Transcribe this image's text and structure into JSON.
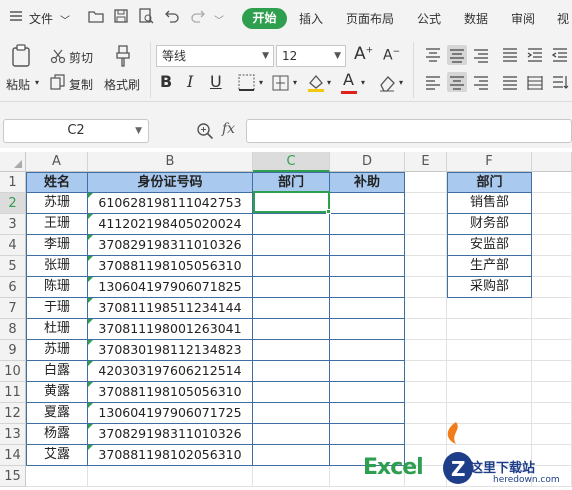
{
  "menubar": {
    "file": "文件",
    "tabs": [
      "开始",
      "插入",
      "页面布局",
      "公式",
      "数据",
      "审阅",
      "视"
    ]
  },
  "ribbon": {
    "paste": "粘贴",
    "cut": "剪切",
    "copy": "复制",
    "format_painter": "格式刷",
    "font_name": "等线",
    "font_size": "12"
  },
  "formula_bar": {
    "name_box": "C2",
    "fx": "fx",
    "value": ""
  },
  "grid": {
    "columns": [
      "A",
      "B",
      "C",
      "D",
      "E",
      "F"
    ],
    "rows": [
      "1",
      "2",
      "3",
      "4",
      "5",
      "6",
      "7",
      "8",
      "9",
      "10",
      "11",
      "12",
      "13",
      "14",
      "15"
    ],
    "headers": [
      "姓名",
      "身份证号码",
      "部门",
      "补助"
    ],
    "records": [
      {
        "name": "苏珊",
        "id": "610628198111042753"
      },
      {
        "name": "王珊",
        "id": "411202198405020024"
      },
      {
        "name": "李珊",
        "id": "370829198311010326"
      },
      {
        "name": "张珊",
        "id": "370881198105056310"
      },
      {
        "name": "陈珊",
        "id": "130604197906071825"
      },
      {
        "name": "于珊",
        "id": "370811198511234144"
      },
      {
        "name": "杜珊",
        "id": "370811198001263041"
      },
      {
        "name": "苏珊",
        "id": "370830198112134823"
      },
      {
        "name": "白露",
        "id": "420303197606212514"
      },
      {
        "name": "黄露",
        "id": "370881198105056310"
      },
      {
        "name": "夏露",
        "id": "130604197906071725"
      },
      {
        "name": "杨露",
        "id": "370829198311010326"
      },
      {
        "name": "艾露",
        "id": "370881198102056310"
      }
    ],
    "dept_header": "部门",
    "departments": [
      "销售部",
      "财务部",
      "安监部",
      "生产部",
      "采购部"
    ]
  },
  "watermark": {
    "excel": "Excel",
    "site": "这里下载站",
    "url": "heredown.com"
  },
  "colors": {
    "accent": "#2e9e4f",
    "header_fill": "#a9c9ee",
    "border": "#3f6fa3"
  }
}
